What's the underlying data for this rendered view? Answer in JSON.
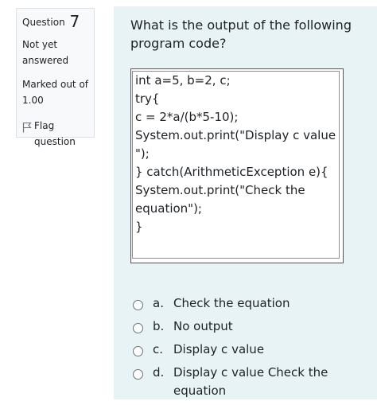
{
  "info": {
    "question_label": "Question",
    "question_number": "7",
    "status_line1": "Not yet",
    "status_line2": "answered",
    "marks_line1": "Marked out of",
    "marks_line2": "1.00",
    "flag_line1": "Flag",
    "flag_line2": "question",
    "flag_icon": "flag-icon"
  },
  "question": {
    "text_line1": "What is the output of the following",
    "text_line2": "program code?"
  },
  "code": {
    "lines": [
      "int a=5, b=2, c;",
      "try{",
      "c = 2*a/(b*5-10);",
      "System.out.print(\"Display c value",
      "\");",
      "} catch(ArithmeticException e){",
      "System.out.print(\"Check the",
      "equation\");",
      "}"
    ]
  },
  "options": [
    {
      "letter": "a.",
      "text": "Check the equation"
    },
    {
      "letter": "b.",
      "text": "No output"
    },
    {
      "letter": "c.",
      "text": "Display c value"
    },
    {
      "letter": "d.",
      "text": "Display c value Check the equation"
    }
  ],
  "colors": {
    "info_bg": "#f8f9fa",
    "question_bg": "#e7f3f5",
    "text": "#1d2125"
  }
}
